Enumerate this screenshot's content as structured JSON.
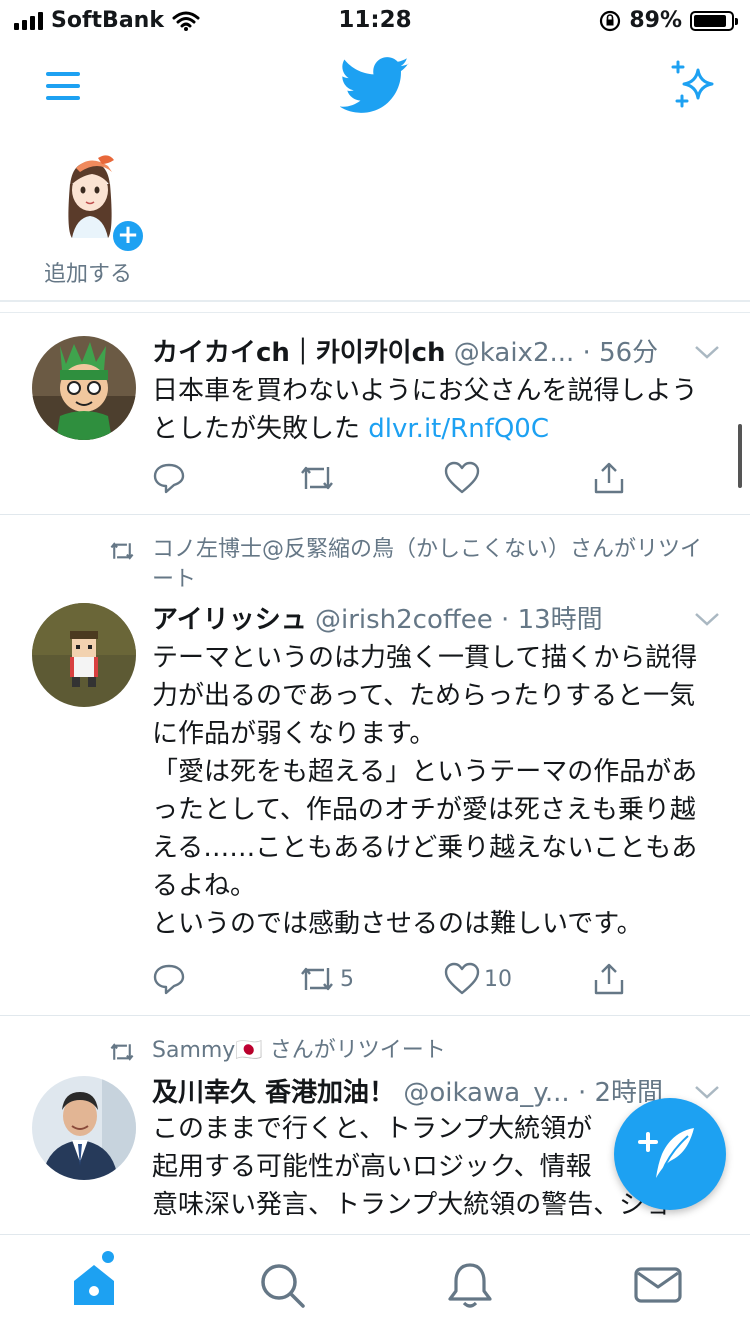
{
  "status_bar": {
    "carrier": "SoftBank",
    "time": "11:28",
    "battery": "89%",
    "battery_level": 0.89
  },
  "nav": {
    "menu_icon": "hamburger-icon",
    "logo_icon": "twitter-bird-icon",
    "sparkle_icon": "sparkle-icon"
  },
  "fleets": {
    "add_label": "追加する"
  },
  "tweets": [
    {
      "name": "カイカイch｜카이카이ch",
      "handle": "@kaix2...",
      "time": "· 56分",
      "text": "日本車を買わないようにお父さんを説得しようとしたが失敗した ",
      "link": "dlvr.it/RnfQ0C",
      "retweets": "",
      "likes": ""
    },
    {
      "retweeted_by": "コノ左博士@反緊縮の鳥（かしこくない）さんがリツイート",
      "name": "アイリッシュ",
      "handle": "@irish2coffee",
      "time": "· 13時間",
      "text": "テーマというのは力強く一貫して描くから説得力が出るのであって、ためらったりすると一気に作品が弱くなります。\n「愛は死をも超える」というテーマの作品があったとして、作品のオチが愛は死さえも乗り越える……こともあるけど乗り越えないこともあるよね。\nというのでは感動させるのは難しいです。",
      "retweets": "5",
      "likes": "10"
    },
    {
      "retweeted_by": "Sammy🇯🇵 さんがリツイート",
      "name": "及川幸久 香港加油！",
      "handle": "@oikawa_y...",
      "time": "· 2時間",
      "text": "このままで行くと、トランプ大統領が\n起用する可能性が高いロジック、情報\n意味深い発言、トランプ大統領の警告、ジョ"
    }
  ],
  "colors": {
    "accent": "#1da1f2",
    "secondary_text": "#657786",
    "divider": "#e1e8ed"
  },
  "tabs": [
    "home-icon",
    "search-icon",
    "bell-icon",
    "mail-icon"
  ]
}
